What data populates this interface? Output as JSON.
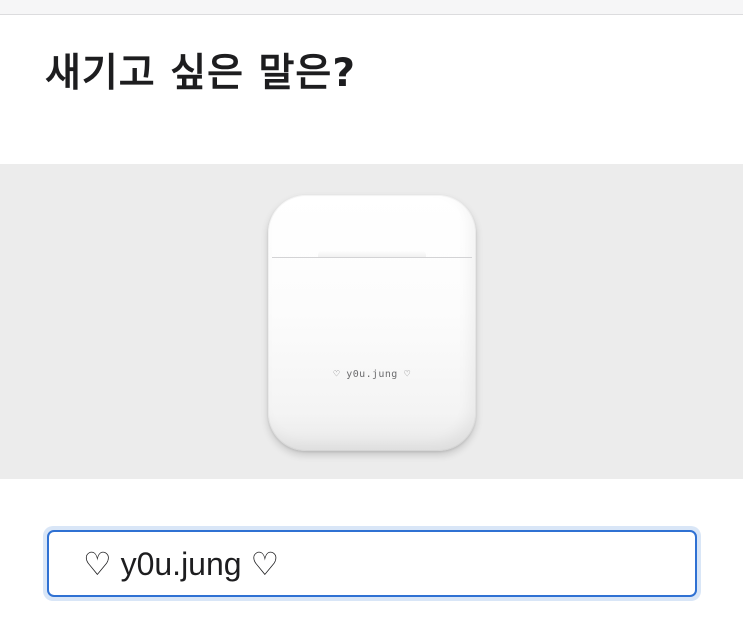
{
  "header": {
    "title": "새기고 싶은 말은?"
  },
  "preview": {
    "product": "airpods-charging-case",
    "engraving_text": "♡ y0u.jung ♡",
    "background_color": "#ececec"
  },
  "engraving_field": {
    "value": "♡ y0u.jung ♡",
    "focus_color": "#2f71d3"
  }
}
